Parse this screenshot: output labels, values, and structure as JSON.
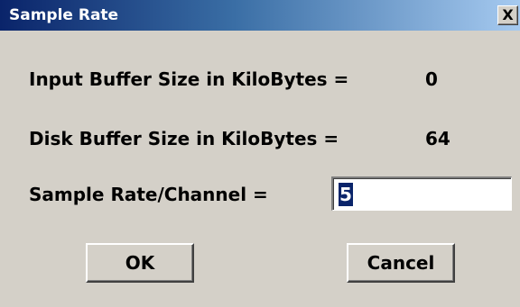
{
  "window": {
    "title": "Sample Rate",
    "close_label": "X"
  },
  "fields": {
    "input_buffer_label": "Input Buffer Size in KiloBytes =",
    "input_buffer_value": "0",
    "disk_buffer_label": "Disk Buffer Size in KiloBytes =",
    "disk_buffer_value": "64",
    "sample_rate_label": "Sample Rate/Channel =",
    "sample_rate_value": "5"
  },
  "buttons": {
    "ok_label": "OK",
    "cancel_label": "Cancel"
  },
  "colors": {
    "title_gradient_start": "#0a246a",
    "title_gradient_end": "#a6caf0",
    "face": "#d4d0c8",
    "selection": "#0a246a"
  }
}
